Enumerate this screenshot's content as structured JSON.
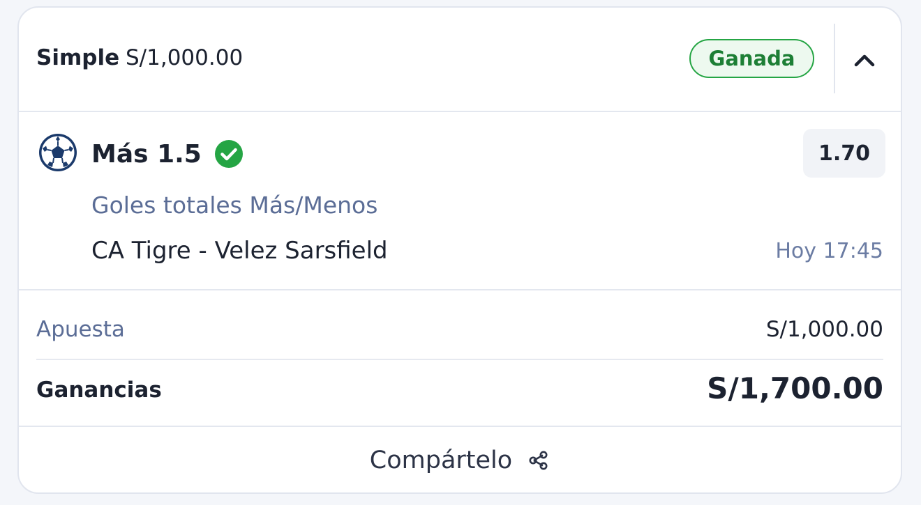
{
  "header": {
    "bet_type": "Simple",
    "stake": "S/1,000.00",
    "status": "Ganada",
    "collapse_icon": "chevron-up-icon"
  },
  "selection": {
    "sport_icon": "soccer-ball-icon",
    "pick": "Más 1.5",
    "result_icon": "check-circle-icon",
    "odds": "1.70",
    "market": "Goles totales Más/Menos",
    "event": "CA Tigre - Velez Sarsfield",
    "time": "Hoy 17:45"
  },
  "summary": {
    "stake_label": "Apuesta",
    "stake_value": "S/1,000.00",
    "winnings_label": "Ganancias",
    "winnings_value": "S/1,700.00"
  },
  "footer": {
    "share_label": "Compártelo",
    "share_icon": "share-icon"
  },
  "colors": {
    "status_green": "#25a544",
    "status_text": "#1d7f35",
    "muted_blue": "#5b6d96",
    "icon_navy": "#1b3a6b"
  }
}
